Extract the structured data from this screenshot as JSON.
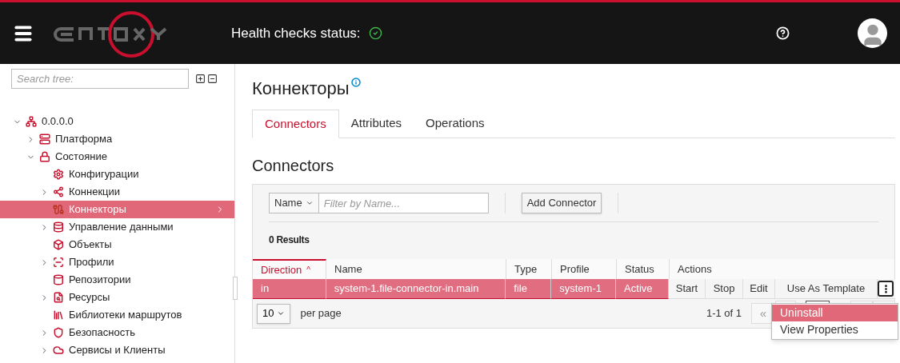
{
  "header": {
    "health_label": "Health checks status:",
    "health_ok": true
  },
  "sidebar": {
    "search": {
      "placeholder": "Search tree:"
    },
    "tree": [
      {
        "label": "0.0.0.0",
        "kind": "branch",
        "expanded": true,
        "selected": false,
        "children": [
          {
            "label": "Платформа",
            "kind": "branch",
            "expanded": false,
            "selected": false
          },
          {
            "label": "Состояние",
            "kind": "branch",
            "expanded": true,
            "selected": false,
            "children": [
              {
                "label": "Конфигурации",
                "kind": "leaf",
                "expanded": false,
                "selected": false
              },
              {
                "label": "Коннекции",
                "kind": "branch",
                "expanded": false,
                "selected": false
              },
              {
                "label": "Коннекторы",
                "kind": "leaf",
                "expanded": false,
                "selected": true
              },
              {
                "label": "Управление данными",
                "kind": "branch",
                "expanded": false,
                "selected": false
              },
              {
                "label": "Объекты",
                "kind": "leaf",
                "expanded": false,
                "selected": false
              },
              {
                "label": "Профили",
                "kind": "branch",
                "expanded": false,
                "selected": false
              },
              {
                "label": "Репозитории",
                "kind": "leaf",
                "expanded": false,
                "selected": false
              },
              {
                "label": "Ресурсы",
                "kind": "branch",
                "expanded": false,
                "selected": false
              },
              {
                "label": "Библиотеки маршрутов",
                "kind": "leaf",
                "expanded": false,
                "selected": false
              },
              {
                "label": "Безопасность",
                "kind": "branch",
                "expanded": false,
                "selected": false
              },
              {
                "label": "Сервисы и Клиенты",
                "kind": "branch",
                "expanded": false,
                "selected": false
              }
            ]
          }
        ]
      }
    ]
  },
  "page": {
    "title": "Коннекторы",
    "tabs": [
      {
        "label": "Connectors",
        "selected": true
      },
      {
        "label": "Attributes",
        "selected": false
      },
      {
        "label": "Operations",
        "selected": false
      }
    ],
    "section_title": "Connectors",
    "toolbar": {
      "filter_field": "Name",
      "filter_placeholder": "Filter by Name...",
      "add_button": "Add Connector"
    },
    "results": "0 Results",
    "table": {
      "columns": [
        {
          "label": "Direction",
          "sorted": true,
          "sort_mark": "^"
        },
        {
          "label": "Name",
          "sorted": false
        },
        {
          "label": "Type",
          "sorted": false
        },
        {
          "label": "Profile",
          "sorted": false
        },
        {
          "label": "Status",
          "sorted": false
        },
        {
          "label": "Actions",
          "sorted": false
        }
      ],
      "rows": [
        {
          "selected": true,
          "cells": [
            "in",
            "system-1.file-connector-in.main",
            "file",
            "system-1",
            "Active"
          ],
          "actions": [
            "Start",
            "Stop",
            "Edit",
            "Use As Template"
          ]
        }
      ]
    },
    "pagination": {
      "per_page_value": "10",
      "per_page_label": "per page",
      "range": "1-1 of 1",
      "first": "«"
    },
    "menu": [
      {
        "label": "Uninstall",
        "selected": true
      },
      {
        "label": "View Properties",
        "selected": false
      }
    ]
  }
}
